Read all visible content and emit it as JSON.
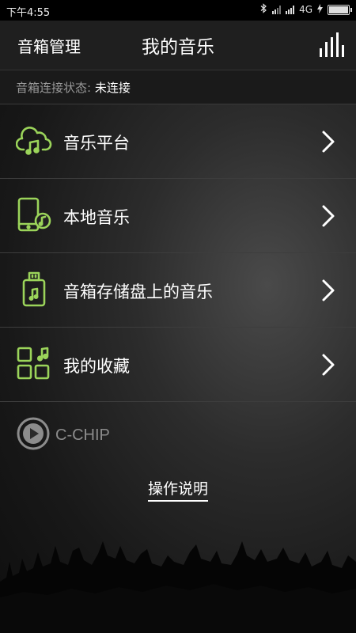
{
  "status_bar": {
    "time": "下午4:55",
    "network": "4G",
    "icons": [
      "bluetooth-icon",
      "signal-off-icon",
      "signal-icon",
      "charging-icon",
      "battery-icon"
    ]
  },
  "header": {
    "left_label": "音箱管理",
    "title": "我的音乐",
    "right_icon": "equalizer-icon"
  },
  "connection": {
    "label": "音箱连接状态:",
    "value": "未连接"
  },
  "menu": {
    "items": [
      {
        "label": "音乐平台",
        "icon": "cloud-music-icon"
      },
      {
        "label": "本地音乐",
        "icon": "phone-music-icon"
      },
      {
        "label": "音箱存储盘上的音乐",
        "icon": "usb-music-icon"
      },
      {
        "label": "我的收藏",
        "icon": "favorites-grid-icon"
      }
    ]
  },
  "brand": {
    "name": "C-CHIP"
  },
  "help": {
    "label": "操作说明"
  },
  "colors": {
    "accent": "#9bd45a",
    "background": "#1e1e1e"
  }
}
